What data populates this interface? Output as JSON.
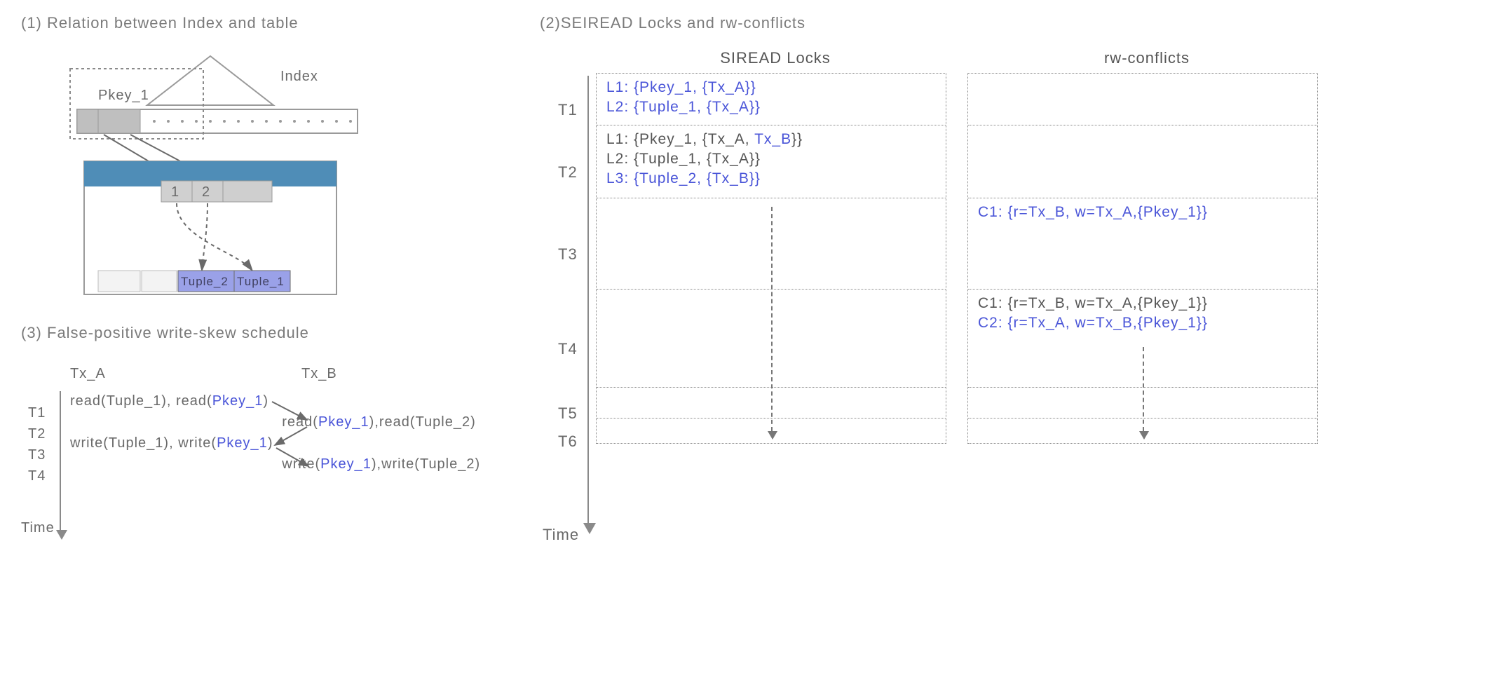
{
  "panel1": {
    "title": "(1) Relation between Index and table",
    "index_label": "Index",
    "pkey_label": "Pkey_1",
    "cell1": "1",
    "cell2": "2",
    "tuple1": "Tuple_1",
    "tuple2": "Tuple_2"
  },
  "panel2": {
    "title": "(2)SEIREAD Locks and rw-conflicts",
    "col_siread": "SIREAD Locks",
    "col_rw": "rw-conflicts",
    "time_label": "Time",
    "t_labels": [
      "T1",
      "T2",
      "T3",
      "T4",
      "T5",
      "T6"
    ],
    "siread": {
      "t1": [
        {
          "text": "L1: {Pkey_1, {Tx_A}}",
          "hl": true
        },
        {
          "text": "L2: {Tuple_1, {Tx_A}}",
          "hl": true
        }
      ],
      "t2": [
        {
          "prefix": "L1: {Pkey_1, {Tx_A, ",
          "hl": "Tx_B",
          "suffix": "}}"
        },
        {
          "text": "L2: {Tuple_1, {Tx_A}}",
          "hl": false
        },
        {
          "text": "L3: {Tuple_2, {Tx_B}}",
          "hl": true
        }
      ]
    },
    "rw": {
      "t3": [
        {
          "text": "C1: {r=Tx_B, w=Tx_A,{Pkey_1}}",
          "hl": true
        }
      ],
      "t4": [
        {
          "text": "C1: {r=Tx_B, w=Tx_A,{Pkey_1}}",
          "hl": false
        },
        {
          "text": "C2: {r=Tx_A, w=Tx_B,{Pkey_1}}",
          "hl": true
        }
      ]
    }
  },
  "panel3": {
    "title": "(3) False-positive write-skew schedule",
    "colA": "Tx_A",
    "colB": "Tx_B",
    "time_label": "Time",
    "t_labels": [
      "T1",
      "T2",
      "T3",
      "T4"
    ],
    "rows": {
      "t1_a_pre": "read(Tuple_1), read(",
      "t1_a_hl": "Pkey_1",
      "t1_a_post": ")",
      "t2_b_pre": "read(",
      "t2_b_hl": "Pkey_1",
      "t2_b_post": "),read(Tuple_2)",
      "t3_a_pre": "write(Tuple_1), write(",
      "t3_a_hl": "Pkey_1",
      "t3_a_post": ")",
      "t4_b_pre": "write(",
      "t4_b_hl": "Pkey_1",
      "t4_b_post": "),write(Tuple_2)"
    }
  }
}
